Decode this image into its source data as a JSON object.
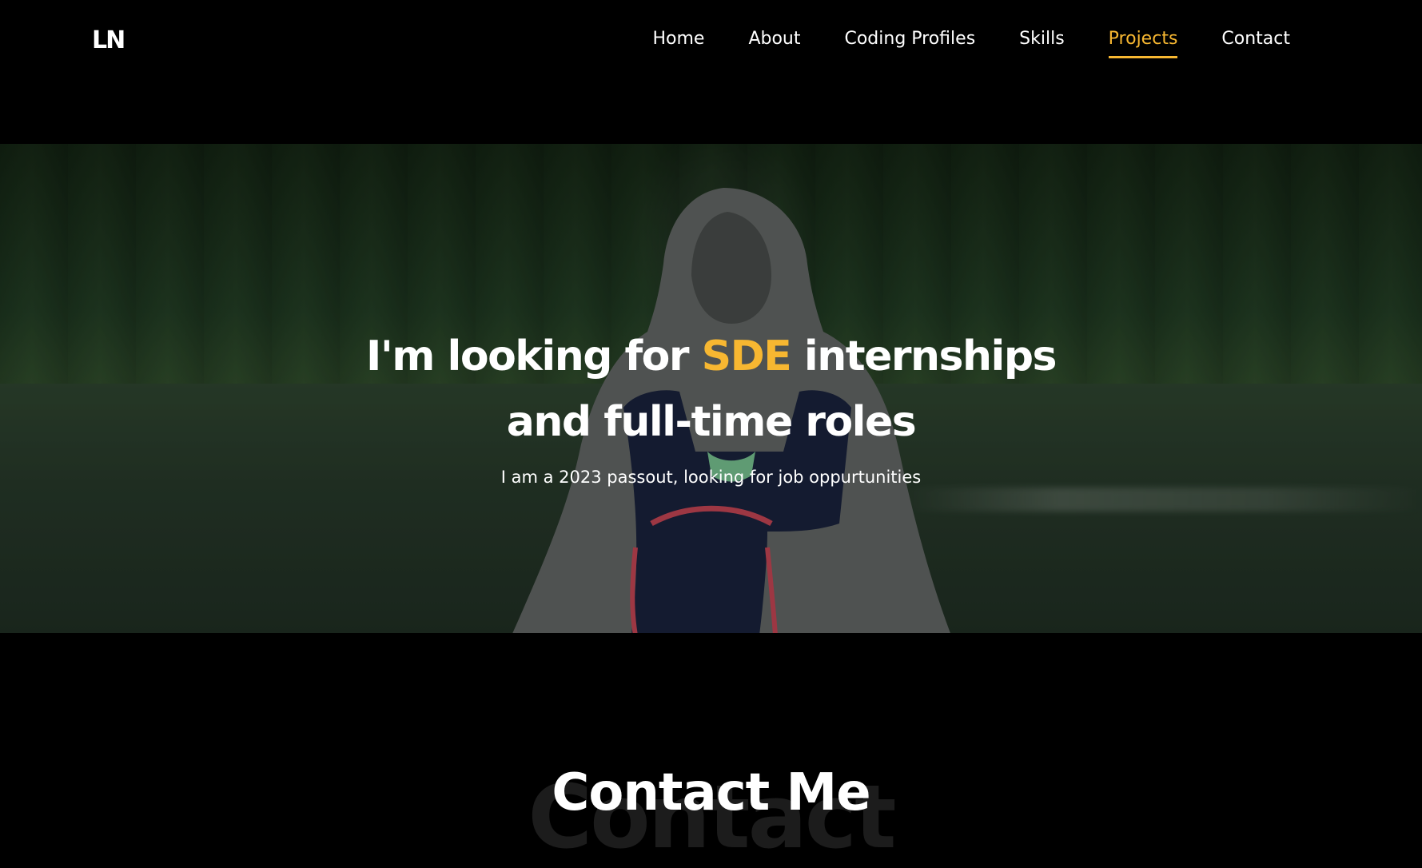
{
  "nav": {
    "logo": "LN",
    "links": [
      {
        "label": "Home"
      },
      {
        "label": "About"
      },
      {
        "label": "Coding Profiles"
      },
      {
        "label": "Skills"
      },
      {
        "label": "Projects",
        "active": true
      },
      {
        "label": "Contact"
      }
    ]
  },
  "hero": {
    "title_before": "I'm looking for ",
    "title_highlight": "SDE",
    "title_after": " internships and full-time roles",
    "subtitle": "I am a 2023 passout, looking for job oppurtunities"
  },
  "contact": {
    "background_text": "Contact",
    "title": "Contact Me"
  },
  "colors": {
    "accent": "#f7b731",
    "background": "#000000",
    "text": "#ffffff"
  }
}
